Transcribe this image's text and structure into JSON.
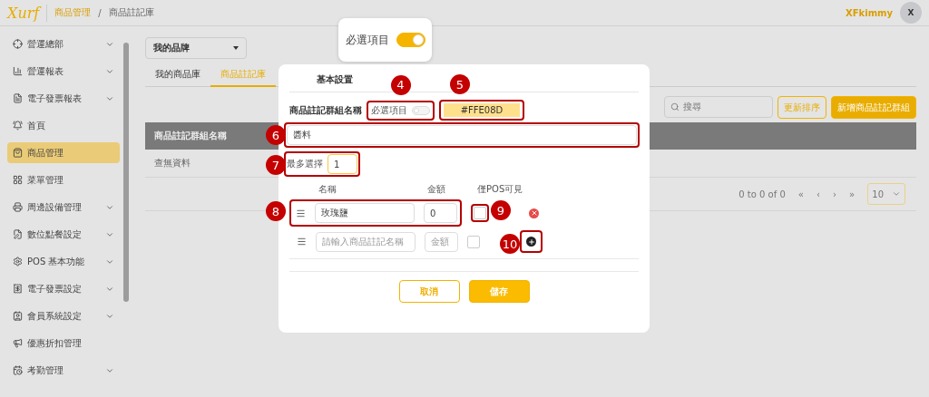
{
  "header": {
    "logo": "Xurf",
    "breadcrumb": [
      "商品管理",
      "商品註記庫"
    ],
    "separator": "/",
    "user": "XFkimmy",
    "avatar": "X"
  },
  "sidebar": {
    "items": [
      {
        "label": "營運總部",
        "expandable": true,
        "selected": false
      },
      {
        "label": "營運報表",
        "expandable": true,
        "selected": false
      },
      {
        "label": "電子發票報表",
        "expandable": true,
        "selected": false
      },
      {
        "label": "首頁",
        "expandable": false,
        "selected": false
      },
      {
        "label": "商品管理",
        "expandable": false,
        "selected": true
      },
      {
        "label": "菜單管理",
        "expandable": false,
        "selected": false
      },
      {
        "label": "周邊設備管理",
        "expandable": true,
        "selected": false
      },
      {
        "label": "數位點餐設定",
        "expandable": true,
        "selected": false
      },
      {
        "label": "POS 基本功能",
        "expandable": true,
        "selected": false
      },
      {
        "label": "電子發票設定",
        "expandable": true,
        "selected": false
      },
      {
        "label": "會員系統設定",
        "expandable": true,
        "selected": false
      },
      {
        "label": "優惠折扣管理",
        "expandable": false,
        "selected": false
      },
      {
        "label": "考勤管理",
        "expandable": true,
        "selected": false
      }
    ]
  },
  "brand_select": {
    "value": "我的品牌"
  },
  "tabs": [
    {
      "label": "我的商品庫",
      "selected": false
    },
    {
      "label": "商品註記庫",
      "selected": true
    }
  ],
  "search": {
    "placeholder": "搜尋"
  },
  "toolbar_buttons": [
    {
      "label": "更新排序",
      "kind": "outline"
    },
    {
      "label": "新增商品註記群組",
      "kind": "filled"
    }
  ],
  "table": {
    "columns": [
      "商品註記群組名稱"
    ],
    "empty_text": "查無資料"
  },
  "pagination": {
    "range": "0 to 0 of 0",
    "controls": [
      "«",
      "‹",
      "›",
      "»"
    ],
    "page_size": "10"
  },
  "tooltip": {
    "label": "必選項目",
    "on": true
  },
  "modal": {
    "tab": "基本設置",
    "name_label": "商品註記群組名稱",
    "required": {
      "label": "必選項目",
      "on": false,
      "callout": "4"
    },
    "color": {
      "value": "#FFE08D",
      "color": "#ffe08d",
      "callout": "5"
    },
    "name_field": {
      "value": "醬料",
      "callout": "6"
    },
    "max_select": {
      "label": "最多選擇",
      "value": "1",
      "callout": "7"
    },
    "columns": [
      "名稱",
      "金額",
      "僅POS可見"
    ],
    "rows": [
      {
        "kind": "item",
        "name": "玫瑰鹽",
        "amount": "0",
        "checked": false,
        "row_callout": "8",
        "check_callout": "9"
      },
      {
        "kind": "new",
        "name_placeholder": "請輸入商品註記名稱",
        "amount_placeholder": "金額",
        "checked": false,
        "action_callout": "10"
      }
    ],
    "buttons": [
      {
        "label": "取消",
        "kind": "outline"
      },
      {
        "label": "儲存",
        "kind": "filled"
      }
    ]
  }
}
